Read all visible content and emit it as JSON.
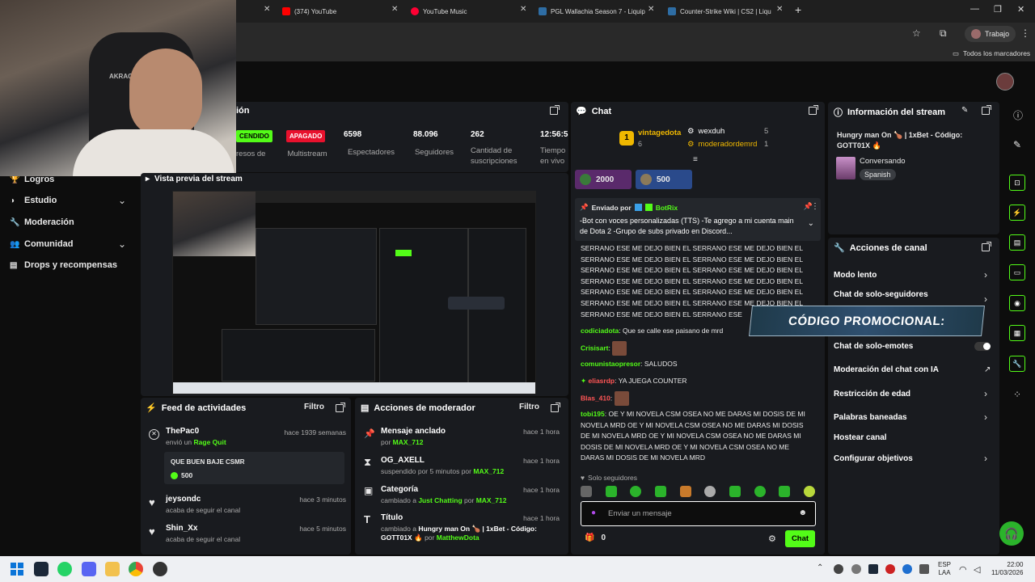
{
  "browser": {
    "tabs": [
      {
        "title": "(374) YouTube",
        "color": "#ff0000"
      },
      {
        "title": "YouTube Music",
        "color": "#ff0033"
      },
      {
        "title": "PGL Wallachia Season 7 - Liquip",
        "color": "#2e6da4"
      },
      {
        "title": "Counter-Strike Wiki | CS2 | Liqu",
        "color": "#2e6da4"
      }
    ],
    "profile": "Trabajo",
    "bookmarks": "Todos los marcadores"
  },
  "sidebar": {
    "items": [
      {
        "label": "Logros",
        "icon": "trophy-icon"
      },
      {
        "label": "Estudio",
        "icon": "palette-icon",
        "chevron": true
      },
      {
        "label": "Moderación",
        "icon": "wrench-icon"
      },
      {
        "label": "Comunidad",
        "icon": "people-icon",
        "chevron": true
      },
      {
        "label": "Drops y recompensas",
        "icon": "drops-icon"
      }
    ]
  },
  "session": {
    "title_partial": "ión",
    "status_on": "CENDIDO",
    "status_off": "APAGADO",
    "stats": [
      {
        "value": "",
        "label": "resos de"
      },
      {
        "value": "",
        "label": "Multistream"
      },
      {
        "value": "6598",
        "label": "Espectadores"
      },
      {
        "value": "88.096",
        "label": "Seguidores"
      },
      {
        "value": "262",
        "label": "Cantidad de suscripciones"
      },
      {
        "value": "12:56:5",
        "label": "Tiempo en vivo"
      }
    ]
  },
  "preview": {
    "title": "Vista previa del stream"
  },
  "feed": {
    "title": "Feed de actividades",
    "filter": "Filtro",
    "items": [
      {
        "name": "ThePac0",
        "sub_pre": "envió un",
        "sub_hl": "Rage Quit",
        "time": "hace 1939 semanas"
      },
      {
        "name": "jeysondc",
        "sub": "acaba de seguir el canal",
        "time": "hace 3 minutos"
      },
      {
        "name": "Shin_Xx",
        "sub": "acaba de seguir el canal",
        "time": "hace 5 minutos"
      }
    ],
    "gift": {
      "message": "QUE BUEN BAJE CSMR",
      "amount": "500"
    }
  },
  "modactions": {
    "title": "Acciones de moderador",
    "filter": "Filtro",
    "items": [
      {
        "title": "Mensaje anclado",
        "sub": "por",
        "user": "MAX_712",
        "time": "hace 1 hora"
      },
      {
        "title": "OG_AXELL",
        "sub": "suspendido por 5 minutos por",
        "user": "MAX_712",
        "time": "hace 1 hora"
      },
      {
        "title": "Categoría",
        "sub": "cambiado a",
        "hl": "Just Chatting",
        "sub2": "por",
        "user": "MAX_712",
        "time": "hace 1 hora"
      },
      {
        "title": "Título",
        "sub": "cambiado a",
        "hl": "Hungry man On 🍗 | 1xBet - Código: GOTT01X 🔥",
        "sub2": "por",
        "user": "MatthewDota",
        "time": "hace 1 hora"
      }
    ]
  },
  "chat": {
    "title": "Chat",
    "leaders": [
      {
        "rank": "1",
        "name": "vintagedota",
        "count": "6"
      },
      {
        "name": "wexduh",
        "count": "5"
      },
      {
        "name": "moderadordemrd",
        "count": "1"
      }
    ],
    "gifts": [
      {
        "amount": "2000"
      },
      {
        "amount": "500"
      }
    ],
    "pinned": {
      "by": "Enviado por",
      "user": "BotRix",
      "text": "-Bot con voces personalizadas (TTS) -Te agrego a mi cuenta main de Dota 2 -Grupo de subs privado en Discord..."
    },
    "spam": "SERRANO ESE ME DEJO BIEN EL SERRANO ESE ME DEJO BIEN EL SERRANO ESE ME DEJO BIEN EL SERRANO ESE ME DEJO BIEN EL SERRANO ESE ME DEJO BIEN EL SERRANO ESE ME DEJO BIEN EL SERRANO ESE ME DEJO BIEN EL SERRANO ESE ME DEJO BIEN EL SERRANO ESE ME DEJO BIEN EL SERRANO ESE ME DEJO BIEN EL SERRANO ESE ME DEJO BIEN EL SERRANO ESE ME DEJO BIEN EL SERRANO ESE ME DEJO BIEN EL SERRANO ESE",
    "messages": [
      {
        "user": "codiciadota",
        "color": "#53fc18",
        "text": "Que se calle ese paisano de mrd"
      },
      {
        "user": "Crisisart",
        "color": "#53fc18",
        "text": ""
      },
      {
        "user": "comunistaopresor",
        "color": "#53fc18",
        "text": "SALUDOS"
      },
      {
        "user": "eliasrdp",
        "color": "#ff5555",
        "text": "YA JUEGA COUNTER"
      },
      {
        "user": "Blas_410",
        "color": "#ff5555",
        "text": ""
      },
      {
        "user": "tobi195",
        "color": "#53fc18",
        "text": "OE Y MI NOVELA CSM OSEA NO ME DARAS MI DOSIS DE MI NOVELA MRD OE Y MI NOVELA CSM OSEA NO ME DARAS MI DOSIS DE MI NOVELA MRD OE Y MI NOVELA CSM OSEA NO ME DARAS MI DOSIS DE MI NOVELA MRD OE Y MI NOVELA CSM OSEA NO ME DARAS MI DOSIS DE MI NOVELA MRD"
      }
    ],
    "followers_only": "Solo seguidores",
    "placeholder": "Enviar un mensaje",
    "points": "0",
    "send": "Chat"
  },
  "streaminfo": {
    "title": "Información del stream",
    "stream_title": "Hungry man On 🍗 | 1xBet - Código: GOTT01X 🔥",
    "category": "Conversando",
    "language": "Spanish"
  },
  "channelactions": {
    "title": "Acciones de canal",
    "items": [
      {
        "label": "Modo lento",
        "type": "chevron"
      },
      {
        "label": "Chat de solo-seguidores",
        "type": "chevron"
      },
      {
        "label": "Chat de solo-emotes",
        "type": "toggle"
      },
      {
        "label": "Moderación del chat con IA",
        "type": "link"
      },
      {
        "label": "Restricción de edad",
        "type": "chevron"
      },
      {
        "label": "Palabras baneadas",
        "type": "chevron"
      },
      {
        "label": "Hostear canal",
        "type": "none"
      },
      {
        "label": "Configurar objetivos",
        "type": "chevron"
      }
    ],
    "promo": "CÓDIGO PROMOCIONAL:"
  },
  "taskbar": {
    "lang": "ESP",
    "region": "LAA",
    "time": "22:00",
    "date": "11/03/2026"
  },
  "colors": {
    "accent": "#53fc18",
    "panel": "#191b1f",
    "bg": "#0d0d0d",
    "danger": "#e8112d"
  }
}
